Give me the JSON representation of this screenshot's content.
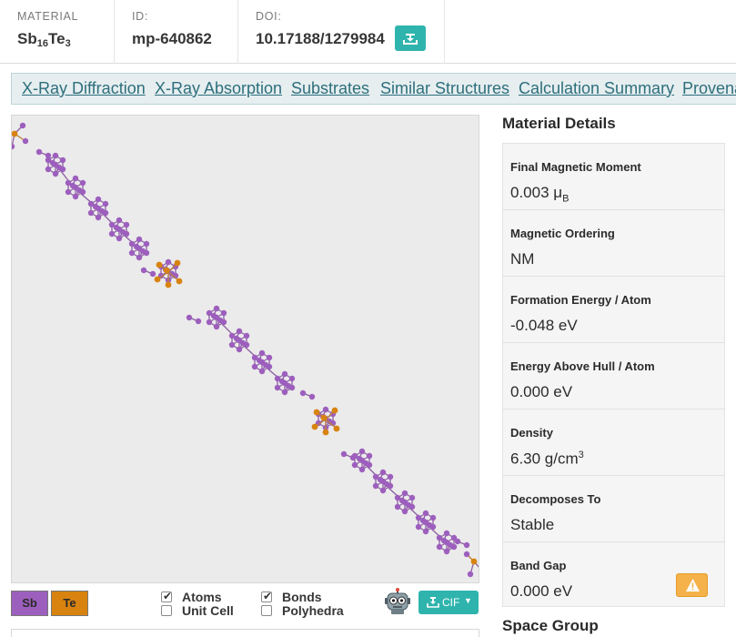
{
  "header": {
    "material_label": "MATERIAL",
    "formula_parts": [
      {
        "text": "Sb",
        "sub": false
      },
      {
        "text": "16",
        "sub": true
      },
      {
        "text": "Te",
        "sub": false
      },
      {
        "text": "3",
        "sub": true
      }
    ],
    "id_label": "ID:",
    "id_value": "mp-640862",
    "doi_label": "DOI:",
    "doi_value": "10.17188/1279984",
    "doi_button_icon": "download-tray-icon"
  },
  "tabs": [
    "X-Ray Diffraction",
    "X-Ray Absorption",
    "Substrates",
    "Similar Structures",
    "Calculation Summary",
    "Provenance"
  ],
  "viewer": {
    "elements": [
      {
        "symbol": "Sb",
        "color": "#9d5fbd"
      },
      {
        "symbol": "Te",
        "color": "#d8830f"
      }
    ],
    "options": {
      "atoms": {
        "label": "Atoms",
        "checked": true
      },
      "unit_cell": {
        "label": "Unit Cell",
        "checked": false
      },
      "bonds": {
        "label": "Bonds",
        "checked": true
      },
      "polyhedra": {
        "label": "Polyhedra",
        "checked": false
      }
    },
    "robot_icon": "robot-icon",
    "cif_button": {
      "label": "CIF",
      "icon": "download-tray-icon",
      "caret": "chevron-down-icon"
    }
  },
  "details": {
    "title": "Material Details",
    "rows": [
      {
        "label": "Final Magnetic Moment",
        "value": "0.003 μ",
        "sub": "B"
      },
      {
        "label": "Magnetic Ordering",
        "value": "NM"
      },
      {
        "label": "Formation Energy / Atom",
        "value": "-0.048 eV"
      },
      {
        "label": "Energy Above Hull / Atom",
        "value": "0.000 eV"
      },
      {
        "label": "Density",
        "value": "6.30 g/cm",
        "sup": "3"
      },
      {
        "label": "Decomposes To",
        "value": "Stable"
      },
      {
        "label": "Band Gap",
        "value": "0.000 eV",
        "warning_icon": "warning-icon"
      }
    ]
  },
  "space_group_title": "Space Group",
  "colors": {
    "accent": "#2fb4ad",
    "link": "#2d6f7c",
    "sb_atom": "#9d5fbd",
    "te_atom": "#d8830f",
    "warning": "#f5b24a"
  }
}
